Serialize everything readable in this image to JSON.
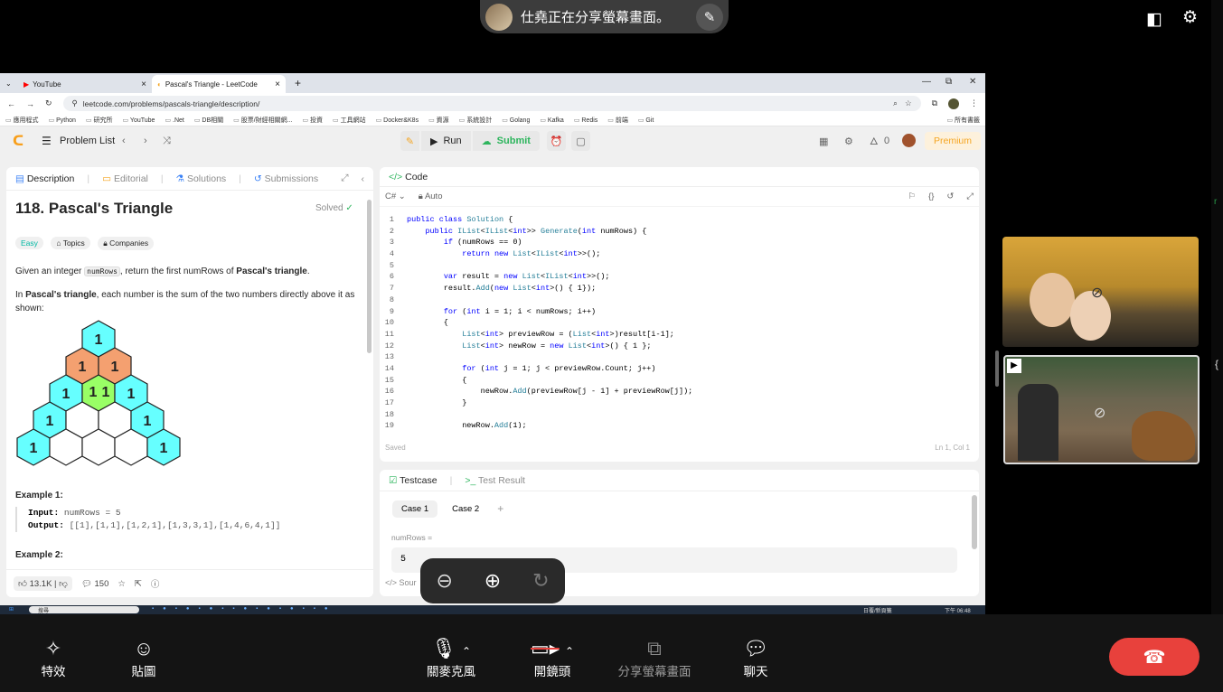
{
  "share": {
    "text": "仕堯正在分享螢幕畫面。"
  },
  "browser": {
    "tabs": [
      {
        "label": "YouTube"
      },
      {
        "label": "Pascal's Triangle - LeetCode"
      }
    ],
    "url": "leetcode.com/problems/pascals-triangle/description/",
    "bookmarks": [
      "應用程式",
      "Python",
      "研究所",
      "YouTube",
      ".Net",
      "DB相關",
      "股票/財經相關網...",
      "投資",
      "工具網站",
      "Docker&K8s",
      "資源",
      "系統設計",
      "Golang",
      "Kafka",
      "Redis",
      "前端",
      "Git",
      "所有書籤"
    ]
  },
  "leetcode": {
    "problem_list": "Problem List",
    "run": "Run",
    "submit": "Submit",
    "streak": "0",
    "premium": "Premium",
    "desc_tabs": [
      "Description",
      "Editorial",
      "Solutions",
      "Submissions"
    ],
    "title": "118. Pascal's Triangle",
    "solved": "Solved",
    "tags": [
      "Easy",
      "Topics",
      "Companies"
    ],
    "para1_pre": "Given an integer ",
    "para1_code": "numRows",
    "para1_mid": ", return the first numRows of ",
    "para1_bold": "Pascal's triangle",
    "para1_end": ".",
    "para2_pre": "In ",
    "para2_bold": "Pascal's triangle",
    "para2_end": ", each number is the sum of the two numbers directly above it as shown:",
    "example1": "Example 1:",
    "input_label": "Input:",
    "input_value": "numRows = 5",
    "output_label": "Output:",
    "output_value": "[[1],[1,1],[1,2,1],[1,3,3,1],[1,4,6,4,1]]",
    "example2": "Example 2:",
    "likes": "13.1K",
    "comments": "150",
    "code_tab": "Code",
    "language": "C#",
    "auto": "Auto",
    "saved": "Saved",
    "cursor": "Ln 1, Col 1",
    "testcase_tab": "Testcase",
    "result_tab": "Test Result",
    "cases": [
      "Case 1",
      "Case 2"
    ],
    "param_label": "numRows =",
    "param_value": "5",
    "source": "Sour",
    "code_lines": [
      "public class Solution {",
      "    public IList<IList<int>> Generate(int numRows) {",
      "        if (numRows == 0)",
      "            return new List<IList<int>>();",
      "",
      "        var result = new List<IList<int>>();",
      "        result.Add(new List<int>() { 1});",
      "",
      "        for (int i = 1; i < numRows; i++)",
      "        {",
      "            List<int> previewRow = (List<int>)result[i-1];",
      "            List<int> newRow = new List<int>() { 1 };",
      "",
      "            for (int j = 1; j < previewRow.Count; j++)",
      "            {",
      "                newRow.Add(previewRow[j - 1] + previewRow[j]);",
      "            }",
      "",
      "            newRow.Add(1);"
    ]
  },
  "taskbar": {
    "search": "搜尋",
    "ime": "日覆/新頁籤",
    "time": "下午 06:48"
  },
  "bottom": {
    "effects": "特效",
    "stickers": "貼圖",
    "mic": "關麥克風",
    "camera": "開鏡頭",
    "share_screen": "分享螢幕畫面",
    "chat": "聊天"
  }
}
